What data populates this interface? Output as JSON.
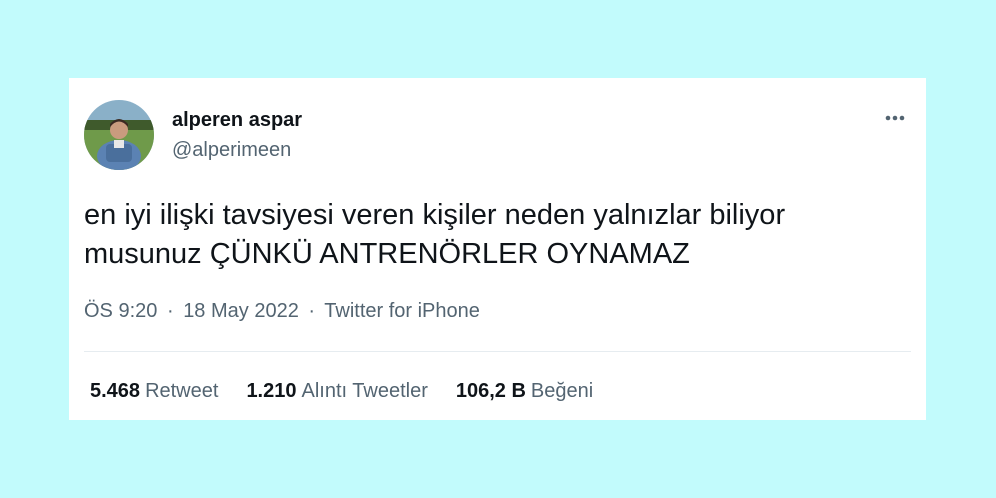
{
  "user": {
    "name": "alperen aspar",
    "handle": "@alperimeen"
  },
  "tweet": {
    "text_line1": "en iyi ilişki tavsiyesi veren kişiler neden yalnızlar biliyor",
    "text_line2": "musunuz ÇÜNKÜ ANTRENÖRLER OYNAMAZ"
  },
  "meta": {
    "time": "ÖS 9:20",
    "separator": "·",
    "date": "18 May 2022",
    "source": "Twitter for iPhone"
  },
  "stats": {
    "retweets_count": "5.468",
    "retweets_label": "Retweet",
    "quotes_count": "1.210",
    "quotes_label": "Alıntı Tweetler",
    "likes_count": "106,2 B",
    "likes_label": "Beğeni"
  },
  "icons": {
    "more": "more-horizontal-icon",
    "avatar": "avatar"
  },
  "colors": {
    "background": "#c2fbfc",
    "card": "#ffffff",
    "text_primary": "#0f1419",
    "text_secondary": "#536471"
  }
}
